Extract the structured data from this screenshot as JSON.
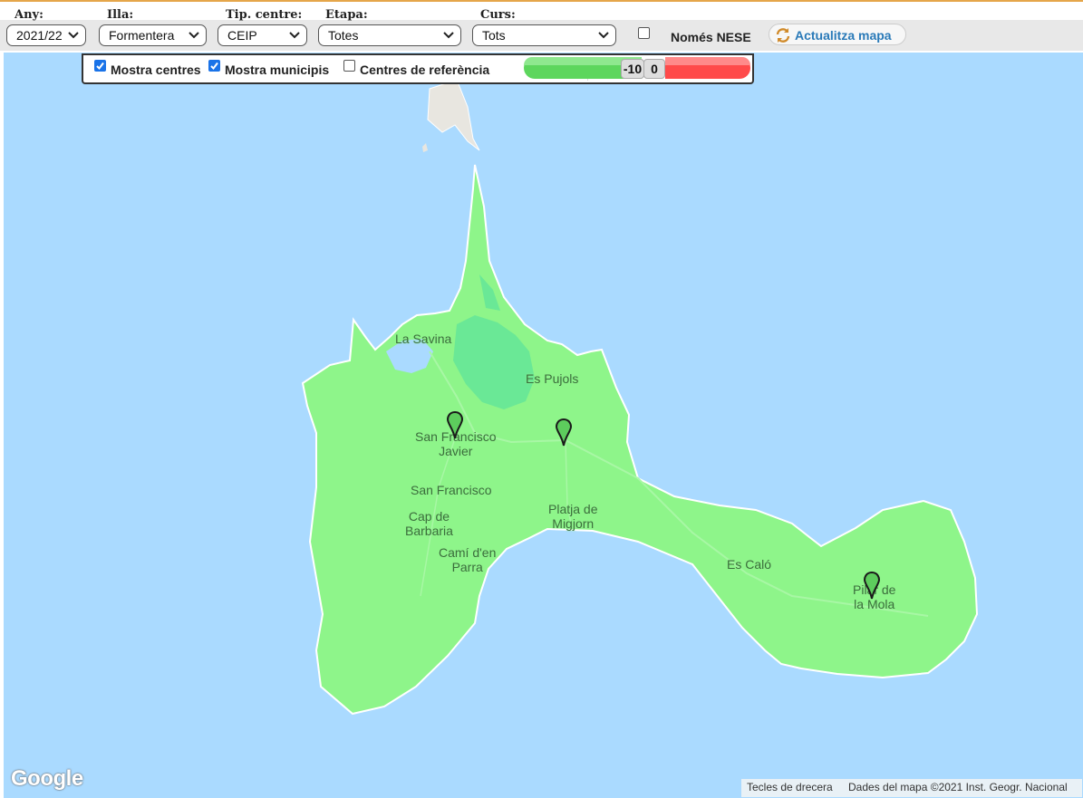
{
  "filters": {
    "any": {
      "label": "Any:",
      "value": "2021/22"
    },
    "illa": {
      "label": "Illa:",
      "value": "Formentera"
    },
    "tipus_centre": {
      "label": "Tip. centre:",
      "value": "CEIP"
    },
    "etapa": {
      "label": "Etapa:",
      "value": "Totes"
    },
    "curs": {
      "label": "Curs:",
      "value": "Tots"
    },
    "nese": {
      "label": "Només NESE",
      "checked": false
    },
    "refresh_label": "Actualitza mapa"
  },
  "map_controls": {
    "mostra_centres": {
      "label": "Mostra centres",
      "checked": true
    },
    "mostra_municipis": {
      "label": "Mostra municipis",
      "checked": true
    },
    "centres_referencia": {
      "label": "Centres de referència",
      "checked": false
    },
    "range_slider": {
      "low_label": "-10",
      "high_label": "0"
    }
  },
  "map": {
    "labels": {
      "la_savina": "La Savina",
      "es_pujols": "Es Pujols",
      "sfj_line1": "San Francisco",
      "sfj_line2": "Javier",
      "san_francisco": "San Francisco",
      "cap_line1": "Cap de",
      "cap_line2": "Barbaria",
      "cami_line1": "Camí d'en",
      "cami_line2": "Parra",
      "platja_line1": "Platja de",
      "platja_line2": "Migjorn",
      "es_calo": "Es Caló",
      "pilar_line1": "Pilar de",
      "pilar_line2": "la Mola"
    },
    "logo": "Google",
    "shortcuts": "Tecles de drecera",
    "attribution": "Dades del mapa ©2021 Inst. Geogr. Nacional",
    "colors": {
      "water": "#aadaff",
      "municipality": "#8ef58a",
      "lagoon": "#6ae896",
      "ibiza_land": "#e8e6e0"
    }
  }
}
